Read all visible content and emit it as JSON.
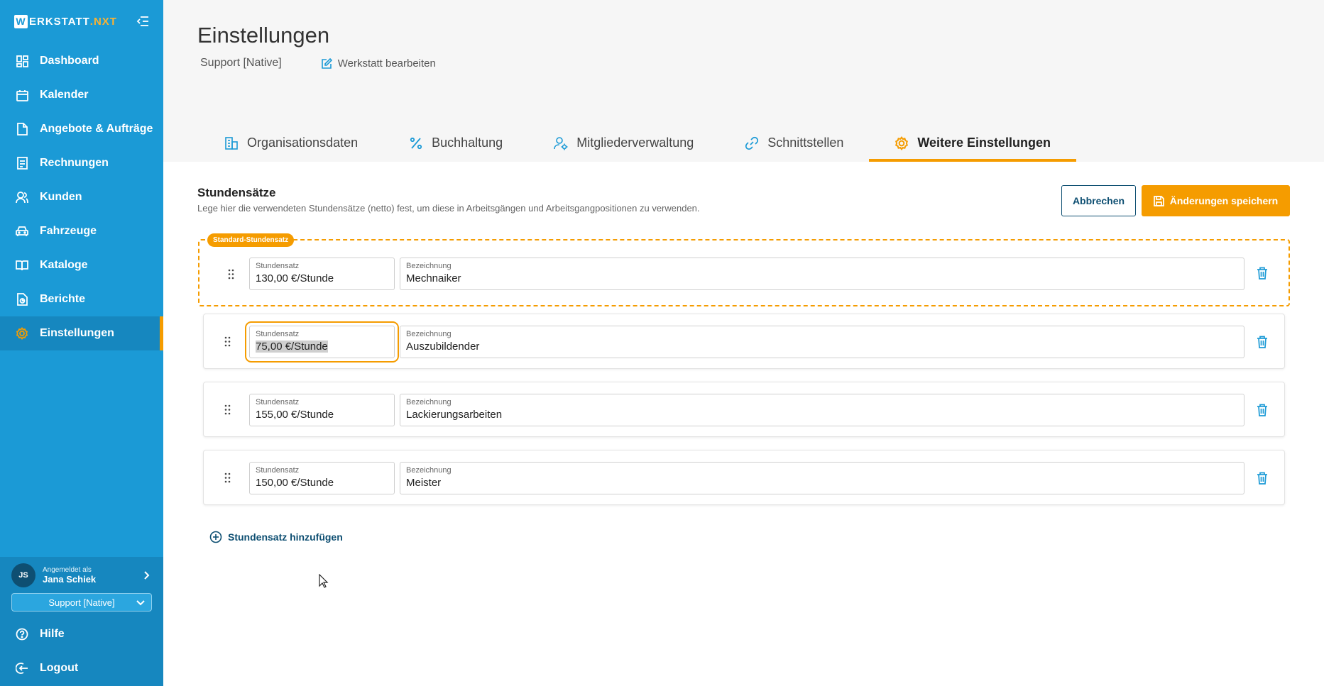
{
  "app": {
    "logo_letter": "W",
    "logo_main": "ERKSTATT",
    "logo_suffix": ".NXT"
  },
  "sidebar": {
    "items": [
      {
        "label": "Dashboard",
        "icon": "dashboard-icon"
      },
      {
        "label": "Kalender",
        "icon": "calendar-icon"
      },
      {
        "label": "Angebote & Aufträge",
        "icon": "document-icon"
      },
      {
        "label": "Rechnungen",
        "icon": "invoice-icon"
      },
      {
        "label": "Kunden",
        "icon": "customers-icon"
      },
      {
        "label": "Fahrzeuge",
        "icon": "car-icon"
      },
      {
        "label": "Kataloge",
        "icon": "book-icon"
      },
      {
        "label": "Berichte",
        "icon": "report-icon"
      },
      {
        "label": "Einstellungen",
        "icon": "gear-icon",
        "active": true
      }
    ],
    "user": {
      "initials": "JS",
      "caption": "Angemeldet als",
      "name": "Jana Schiek"
    },
    "workshop_select": "Support [Native]",
    "bottom": [
      {
        "label": "Hilfe",
        "icon": "help-icon"
      },
      {
        "label": "Logout",
        "icon": "logout-icon"
      }
    ]
  },
  "header": {
    "title": "Einstellungen",
    "workshop": "Support [Native]",
    "edit_link": "Werkstatt bearbeiten"
  },
  "tabs": [
    {
      "label": "Organisationsdaten",
      "icon": "building-icon"
    },
    {
      "label": "Buchhaltung",
      "icon": "percent-icon"
    },
    {
      "label": "Mitgliederverwaltung",
      "icon": "user-gear-icon"
    },
    {
      "label": "Schnittstellen",
      "icon": "link-icon"
    },
    {
      "label": "Weitere Einstellungen",
      "icon": "gear-icon",
      "active": true
    }
  ],
  "section": {
    "title": "Stundensätze",
    "description": "Lege hier die verwendeten Stundensätze (netto) fest, um diese in Arbeitsgängen und Arbeitsgangpositionen zu verwenden.",
    "cancel_label": "Abbrechen",
    "save_label": "Änderungen speichern",
    "default_badge": "Standard-Stundensatz",
    "rate_label": "Stundensatz",
    "name_label": "Bezeichnung",
    "add_label": "Stundensatz hinzufügen"
  },
  "rates": [
    {
      "rate": "130,00 €/Stunde",
      "name": "Mechnaiker",
      "default": true
    },
    {
      "rate": "75,00 €/Stunde",
      "name": "Auszubildender",
      "focused": true
    },
    {
      "rate": "155,00 €/Stunde",
      "name": "Lackierungsarbeiten"
    },
    {
      "rate": "150,00 €/Stunde",
      "name": "Meister"
    }
  ],
  "colors": {
    "sidebar": "#1b9ad6",
    "accent": "#f59c00",
    "primary_dark": "#0e4f72"
  }
}
